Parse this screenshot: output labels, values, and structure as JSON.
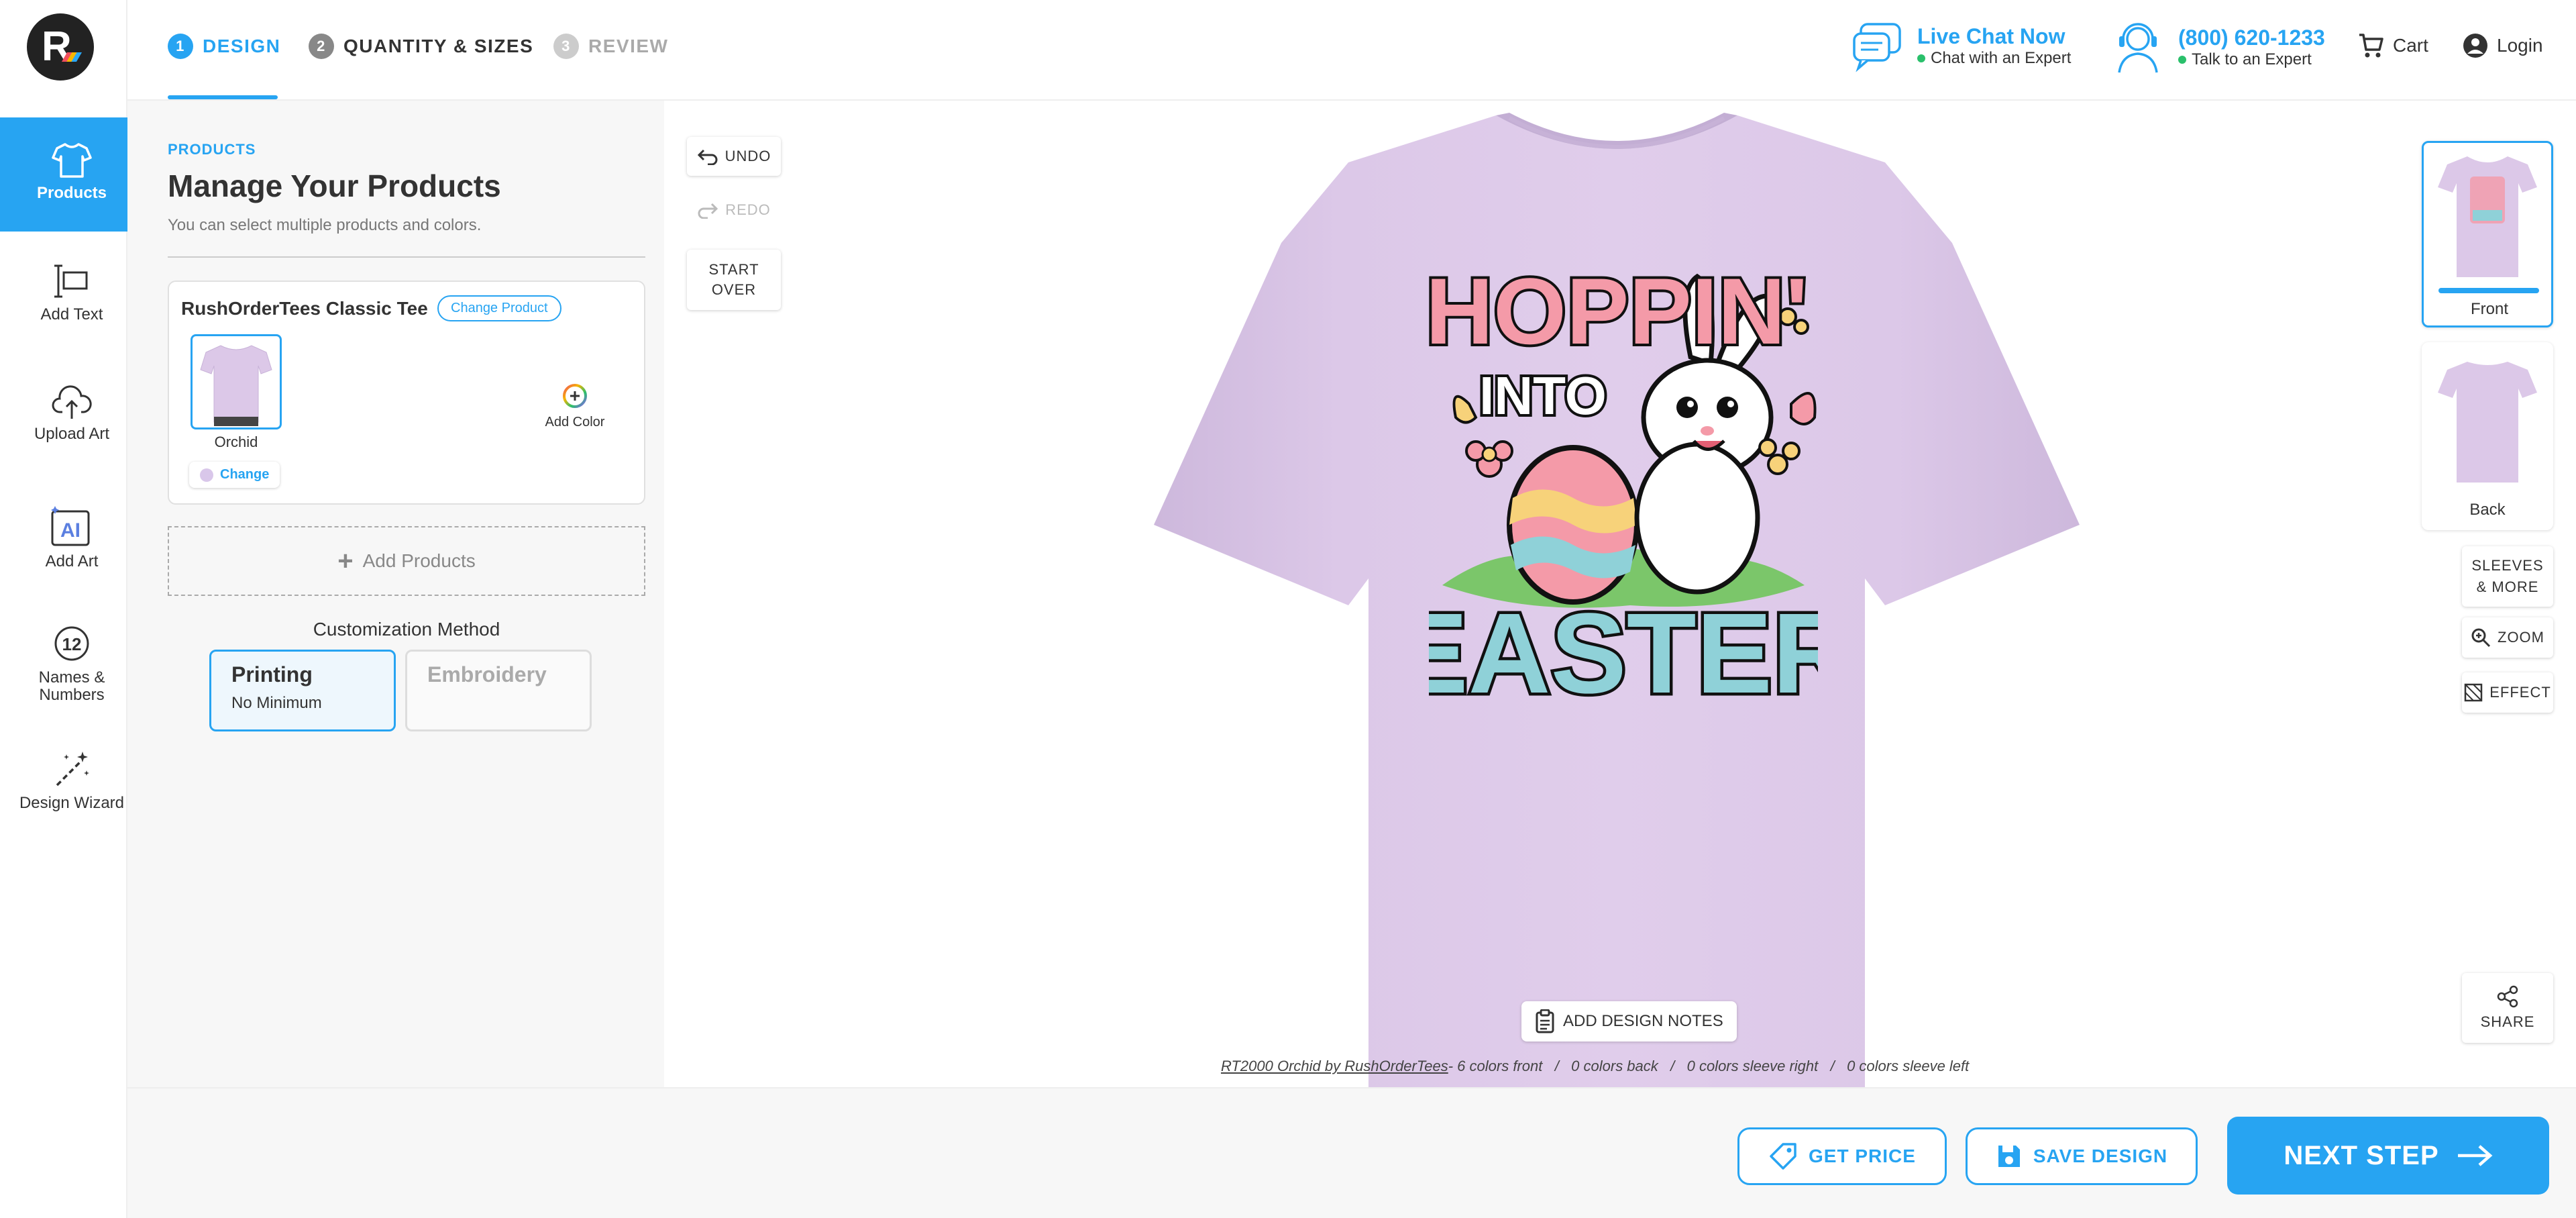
{
  "header": {
    "steps": [
      {
        "num": "1",
        "label": "DESIGN"
      },
      {
        "num": "2",
        "label": "QUANTITY & SIZES"
      },
      {
        "num": "3",
        "label": "REVIEW"
      }
    ],
    "live_chat": {
      "title": "Live Chat Now",
      "subtitle": "Chat with an Expert"
    },
    "phone": {
      "title": "(800) 620-1233",
      "subtitle": "Talk to an Expert"
    },
    "cart_label": "Cart",
    "login_label": "Login"
  },
  "sidebar": {
    "items": [
      {
        "label": "Products",
        "icon": "tshirt-icon"
      },
      {
        "label": "Add Text",
        "icon": "text-icon"
      },
      {
        "label": "Upload Art",
        "icon": "cloud-upload-icon"
      },
      {
        "label": "Add Art",
        "icon": "ai-icon"
      },
      {
        "label": "Names &",
        "label2": "Numbers",
        "icon": "number-icon"
      },
      {
        "label": "Design Wizard",
        "icon": "magic-wand-icon"
      }
    ]
  },
  "products_panel": {
    "eyebrow": "PRODUCTS",
    "title": "Manage Your Products",
    "subtitle": "You can select multiple products and colors.",
    "product": {
      "name": "RushOrderTees Classic Tee",
      "change_product_label": "Change Product",
      "color_name": "Orchid",
      "change_label": "Change",
      "add_color_label": "Add Color"
    },
    "add_products_label": "Add Products",
    "customization": {
      "label": "Customization Method",
      "options": [
        {
          "title": "Printing",
          "subtitle": "No Minimum",
          "selected": true
        },
        {
          "title": "Embroidery",
          "subtitle": "",
          "selected": false
        }
      ]
    }
  },
  "canvas": {
    "undo_label": "UNDO",
    "redo_label": "REDO",
    "start_over_line1": "START",
    "start_over_line2": "OVER",
    "design_text": {
      "line1": "HOPPIN'",
      "line2": "INTO",
      "line3": "EASTER"
    },
    "shirt_color": "#dcc8e8",
    "add_design_notes_label": "ADD DESIGN NOTES",
    "info": {
      "product_link": "RT2000 Orchid by RushOrderTees",
      "front": "- 6 colors front",
      "back": "0 colors back",
      "sleeve_right": "0 colors sleeve right",
      "sleeve_left": "0 colors sleeve left",
      "sep": "/"
    },
    "views": [
      {
        "label": "Front",
        "selected": true
      },
      {
        "label": "Back",
        "selected": false
      }
    ],
    "sleeves_line1": "SLEEVES",
    "sleeves_line2": "& MORE",
    "zoom_label": "ZOOM",
    "effect_label": "EFFECT",
    "share_label": "SHARE"
  },
  "footer": {
    "get_price_label": "GET PRICE",
    "save_design_label": "SAVE DESIGN",
    "next_step_label": "NEXT STEP"
  },
  "colors": {
    "accent": "#27a4f2",
    "shirt": "#dcc8e8",
    "online": "#2ac06b"
  }
}
